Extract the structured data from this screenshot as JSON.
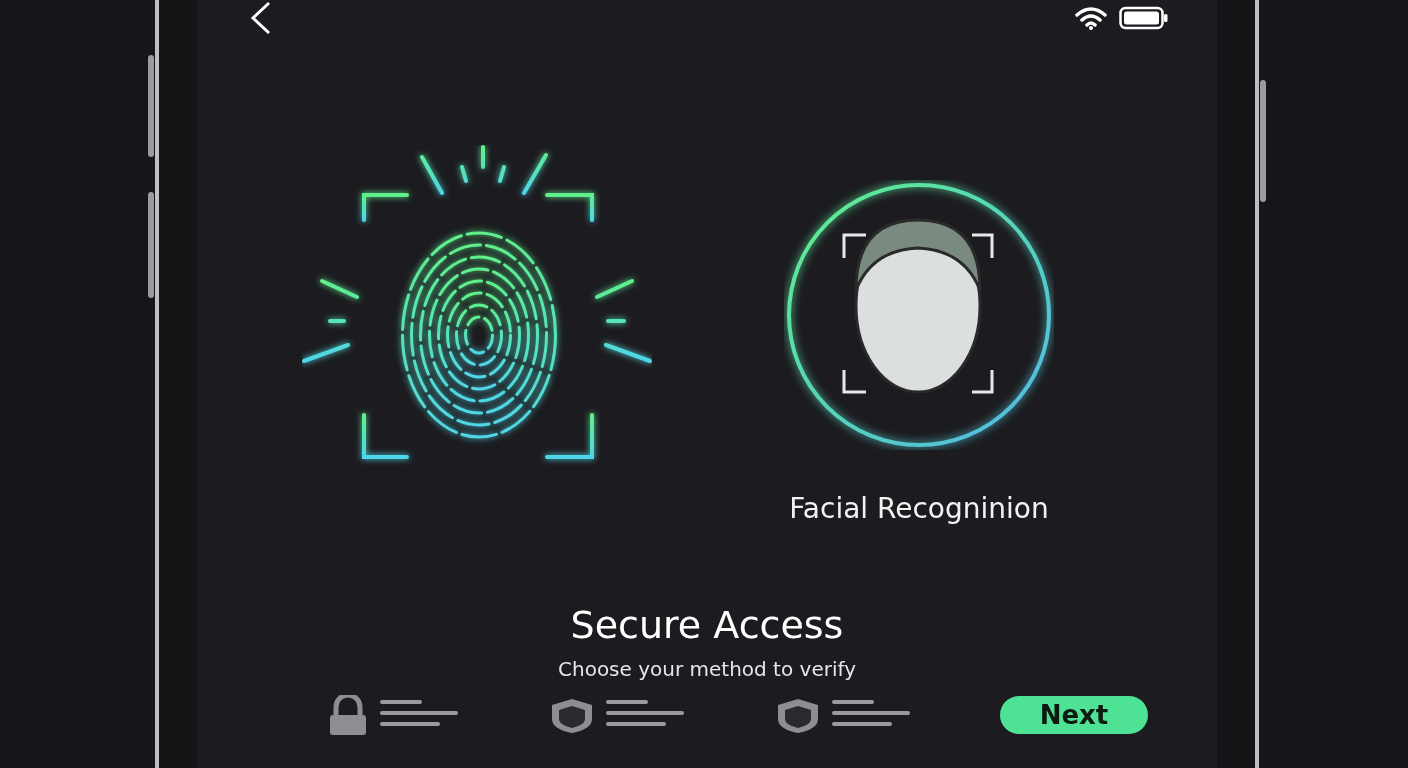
{
  "methods": [
    {
      "kind": "fingerprint"
    },
    {
      "kind": "face",
      "label": "Facial Recogninion"
    }
  ],
  "title": "Secure Access",
  "subtitle": "Choose your method to verify",
  "options": [
    {
      "kind": "lock"
    },
    {
      "kind": "shield"
    },
    {
      "kind": "shield"
    }
  ],
  "next_button": "Next"
}
